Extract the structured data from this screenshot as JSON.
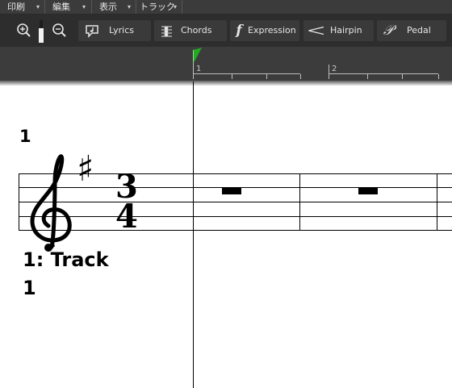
{
  "menubar": {
    "items": [
      {
        "label": "印刷"
      },
      {
        "label": "編集"
      },
      {
        "label": "表示"
      },
      {
        "label": "トラック"
      }
    ]
  },
  "toolbar": {
    "buttons": [
      {
        "label": "Lyrics",
        "icon": "lyrics-icon"
      },
      {
        "label": "Chords",
        "icon": "chords-icon"
      },
      {
        "label": "Expression",
        "icon": "expression-icon",
        "glyph": "f"
      },
      {
        "label": "Hairpin",
        "icon": "hairpin-icon"
      },
      {
        "label": "Pedal",
        "icon": "pedal-icon",
        "glyph": "𝒫"
      }
    ]
  },
  "ruler": {
    "marks": [
      "1",
      "2"
    ],
    "marker_color": "#22aa22"
  },
  "score": {
    "page_number": "1",
    "time_signature": {
      "top": "3",
      "bottom": "4"
    },
    "key_signature": "♯",
    "clef": "treble-clef",
    "track_label": "1: Track",
    "track_number": "1"
  }
}
